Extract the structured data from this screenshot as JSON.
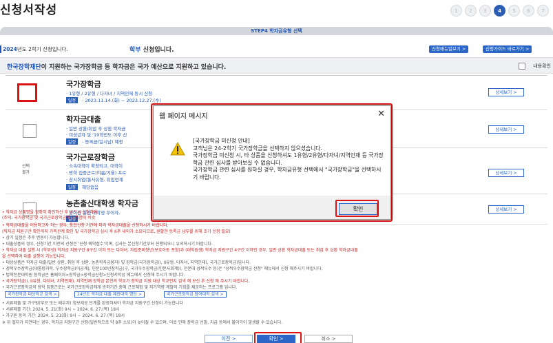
{
  "page": {
    "title": "신청서작성",
    "steps": [
      "1",
      "2",
      "3",
      "4",
      "5",
      "6",
      "7"
    ],
    "active_step": "4"
  },
  "header": {
    "step_title": "STEP4 학자금유형 선택",
    "year_prefix": "2024",
    "year_suffix": "년도 2학기 신청입니다.",
    "applicant_type": "학부",
    "applicant_suffix": " 신청입니다.",
    "manual_button": "신청매뉴얼보기 >",
    "guide_button": "신청가이드 바로가기 >"
  },
  "notice": {
    "org": "한국장학재단",
    "text1": "이 지원하는 ",
    "bold1": "국가장학금 등 학자금",
    "text2": "은 국가 예산으로 ",
    "bold2": "지원하고 있습니다.",
    "confirm_label": "내용확인"
  },
  "items": [
    {
      "title": "국가장학금",
      "line1": "· 1유형 / 2유형 / 다자녀 / 지역인재 동시 신청",
      "schedule_tag": "일정",
      "line2": " - 2023.11.14.(화) ~ 2023.12.27.(수)",
      "detail": "상세보기 >"
    },
    {
      "title": "학자금대출",
      "line1": "· 일반 상환/취업 후 상환 학자금",
      "line1b": "· 미성년자 및 '19학번도 이후 신",
      "schedule_tag": "일정",
      "line2": " - 등록금(일시납) 예정",
      "detail": "상세보기 >"
    },
    {
      "disabled_label": "선택\n불가",
      "title": "국가근로장학금",
      "line1": "· 소속대학이 확정되고, 대학이",
      "line1b": "· 방학 집중근로(여름/겨울) 프로",
      "line1c": "· 상시취업(통사유형, 취업연계",
      "schedule_tag": "일정",
      "line2": " 해당없음",
      "detail": "상세보기 >"
    },
    {
      "title": "농촌출신대학생 학자금",
      "line1": "· 농어촌 출신 대학생 무이자,",
      "schedule_tag": "일정",
      "line2": "",
      "detail": "상세보기 >"
    }
  ],
  "notes": [
    "• 학자금 상품명을 정확히 확인하신 후 반드시 신청하여",
    "(주의: 국가장학금 및 국가근로장학금의 상품명이 비슷",
    "• 학자금대출을 이용하고자 하는 경우, 통합신청 기간에 미리 학자금대출을 신청하시기 바랍니다.",
    "(학자금 지원구간 확인까지 가족관계 확인 및 국가장학금 심사 후 6주 내외가 소요되므로, 원활한 등록금 납부를 위해 조기 신청 필요)",
    "• 상기 일정은 추후 변동이 가능합니다.",
    "• 대출상품의 경우, 신청기간 이전의 신청은 '신청 예약접수'이며, 심사는 본신청기간부터 진행되오니 유의하시기 바랍니다.",
    "• 학자금 대출 실행 시 (학부생) 학자금 지원구간 8구간 이하 또는 다자녀, 자립준비청년(보호아동 포함)과 (대학원생) 학자금 지원구간 4구간 이하인 경우, 일반 상환 학자금대출 또는 취업 후 상환 학자금대출",
    "을 선택하여 대출 실행이 가능합니다.",
    "• 대상상품은 학자금 대출(일반 상환, 취업 후 상환, 농촌학자금융자) 및 장학금(국가장학금(I, II유형, 다자녀, 지역인재), 국가근로장학금)입니다.",
    "• 성적우수장학금(대통령과학, 우수장학금(이공계), 인문100년장학금(구, 국가우수장학금(인문사회계)), 전문대 성적우수 등)은 \"성적우수장학금 신청\" 메뉴에서 신청 해주시기 바랍니다.",
    "• 법학전문대학원 장학금은 홈페이지>장학금>장학금신청>신청서작성 메뉴에서 신청해 주시기 바랍니다.",
    "• 국가장학금(I, II유형, 다자녀, 지역인재), 지역인재 장학금 본인의 학교가 장학금 지원 대상 학교인지 검색 해 보신 후 신청 해 주시기 바랍니다.",
    "• 국가근로장학금의 방학 집중근로는 국가근로장학금에게 방학기간 중에 근로체험 및 자기역량 계발의 기회를 제공하는 프로그램 입니다.",
    "• 서류제출 및 가구원(부모 또는 배우자) 정보제공 단계를 완료하셔야 학자금 지원구간 산정이 가능합니다",
    "• 서류제출 기간: 2024. 5. 21(화) 9시 ~ 2024. 6. 27.(목) 18시",
    "• 가구원 동의 기간: 2024. 5. 21(화) 9시 ~ 2024. 6. 27.(목) 18시",
    "※ 위 절차가 지연되는 경우, 학자금 지원구간 산정(일반적으로 약 8주 소요)이 늦어질 수 있으며, 이로 인해 장학금 선발, 지급 등에서 불이익이 발생할 수 있습니다."
  ],
  "search_buttons": [
    "국가장학금 대상학교 검색 >",
    "24년도 학자금 대출 제한대학 명단 >",
    "국가근로장학금 참여대학 검색 >"
  ],
  "footer": {
    "prev": "이전 >",
    "confirm": "확인 >",
    "cancel": "취소 >"
  },
  "dialog": {
    "title": "웹 페이지 메시지",
    "close": "✕",
    "message": "[국가장학금 미신청 안내]\n고객님은 24-2학기 국가장학금을 선택하지 않으셨습니다.\n국가장학금 미신청 시, 타 상품을 신청하셔도 1유형/2유형/다자녀/지역인재 등 국가장학금 관련 심사를 받아보실 수 없습니다.\n국가장학금 관련 심사를 원하실 경우, 학자금유형 선택에서 \"국가장학금\"을 선택하시기 바랍니다.",
    "ok": "확인"
  },
  "colors": {
    "accent": "#2c66c7",
    "highlight_red": "#dd1111",
    "warning_yellow": "#f2c200"
  }
}
